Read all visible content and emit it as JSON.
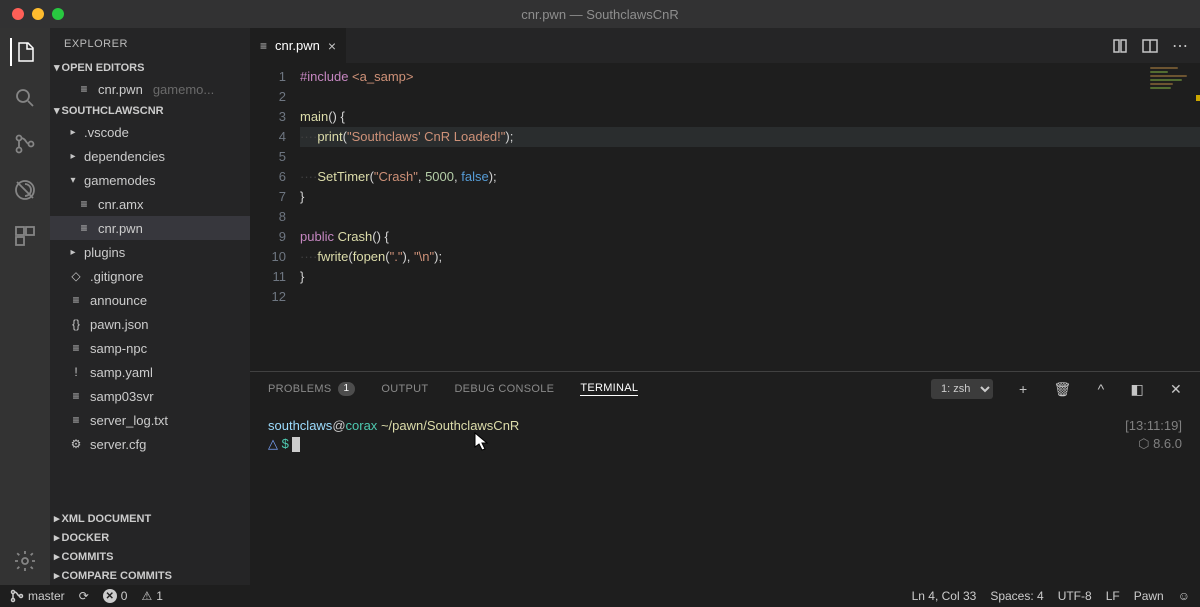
{
  "window": {
    "title": "cnr.pwn — SouthclawsCnR"
  },
  "activity": {
    "active": "explorer"
  },
  "sidebar": {
    "title": "EXPLORER",
    "sections": {
      "open_editors": "OPEN EDITORS",
      "workspace": "SOUTHCLAWSCNR",
      "xml": "XML DOCUMENT",
      "docker": "DOCKER",
      "commits": "COMMITS",
      "compare": "COMPARE COMMITS"
    },
    "open_editor_item": {
      "name": "cnr.pwn",
      "path": "gamemo..."
    },
    "tree": [
      {
        "label": ".vscode",
        "kind": "folder",
        "chev": "▸",
        "indent": 2
      },
      {
        "label": "dependencies",
        "kind": "folder",
        "chev": "▸",
        "indent": 2
      },
      {
        "label": "gamemodes",
        "kind": "folder",
        "chev": "▾",
        "indent": 2
      },
      {
        "label": "cnr.amx",
        "kind": "file",
        "icon": "≡",
        "indent": 1
      },
      {
        "label": "cnr.pwn",
        "kind": "file",
        "icon": "≡",
        "indent": 1,
        "selected": true
      },
      {
        "label": "plugins",
        "kind": "folder",
        "chev": "▸",
        "indent": 2
      },
      {
        "label": ".gitignore",
        "kind": "file",
        "icon": "◇",
        "indent": 2
      },
      {
        "label": "announce",
        "kind": "file",
        "icon": "≡",
        "indent": 2
      },
      {
        "label": "pawn.json",
        "kind": "file",
        "icon": "{}",
        "indent": 2
      },
      {
        "label": "samp-npc",
        "kind": "file",
        "icon": "≡",
        "indent": 2
      },
      {
        "label": "samp.yaml",
        "kind": "file",
        "icon": "!",
        "indent": 2
      },
      {
        "label": "samp03svr",
        "kind": "file",
        "icon": "≡",
        "indent": 2
      },
      {
        "label": "server_log.txt",
        "kind": "file",
        "icon": "≡",
        "indent": 2
      },
      {
        "label": "server.cfg",
        "kind": "file",
        "icon": "⚙",
        "indent": 2
      }
    ]
  },
  "editor": {
    "tab": {
      "label": "cnr.pwn"
    },
    "lines": [
      [
        {
          "t": "#include ",
          "c": "tk-inc"
        },
        {
          "t": "<a_samp>",
          "c": "tk-str"
        }
      ],
      [],
      [
        {
          "t": "main",
          "c": "tk-fn"
        },
        {
          "t": "() {",
          "c": "tk-plain"
        }
      ],
      [
        {
          "t": "····",
          "c": "tk-dot"
        },
        {
          "t": "print",
          "c": "tk-fn"
        },
        {
          "t": "(",
          "c": "tk-plain"
        },
        {
          "t": "\"Southclaws' CnR Loaded!\"",
          "c": "tk-str"
        },
        {
          "t": ");",
          "c": "tk-plain"
        }
      ],
      [],
      [
        {
          "t": "····",
          "c": "tk-dot"
        },
        {
          "t": "SetTimer",
          "c": "tk-fn"
        },
        {
          "t": "(",
          "c": "tk-plain"
        },
        {
          "t": "\"Crash\"",
          "c": "tk-str"
        },
        {
          "t": ", ",
          "c": "tk-plain"
        },
        {
          "t": "5000",
          "c": "tk-num"
        },
        {
          "t": ", ",
          "c": "tk-plain"
        },
        {
          "t": "false",
          "c": "tk-bool"
        },
        {
          "t": ");",
          "c": "tk-plain"
        }
      ],
      [
        {
          "t": "}",
          "c": "tk-plain"
        }
      ],
      [],
      [
        {
          "t": "public ",
          "c": "tk-kw"
        },
        {
          "t": "Crash",
          "c": "tk-fn"
        },
        {
          "t": "() {",
          "c": "tk-plain"
        }
      ],
      [
        {
          "t": "····",
          "c": "tk-dot"
        },
        {
          "t": "fwrite",
          "c": "tk-fn"
        },
        {
          "t": "(",
          "c": "tk-plain"
        },
        {
          "t": "fopen",
          "c": "tk-fn"
        },
        {
          "t": "(",
          "c": "tk-plain"
        },
        {
          "t": "\".\"",
          "c": "tk-str"
        },
        {
          "t": "), ",
          "c": "tk-plain"
        },
        {
          "t": "\"\\n\"",
          "c": "tk-str"
        },
        {
          "t": ");",
          "c": "tk-plain"
        }
      ],
      [
        {
          "t": "}",
          "c": "tk-plain"
        }
      ],
      []
    ],
    "highlight_line": 4
  },
  "panel": {
    "tabs": {
      "problems": "PROBLEMS",
      "problems_count": "1",
      "output": "OUTPUT",
      "debug": "DEBUG CONSOLE",
      "terminal": "TERMINAL"
    },
    "terminal_select": "1: zsh",
    "terminal": {
      "user": "southclaws",
      "at": "@",
      "host": "corax",
      "path": "~/pawn/SouthclawsCnR",
      "time": "[13:11:19]",
      "node_icon": "⬡",
      "node_ver": "8.6.0",
      "delta": "△",
      "dollar": "$"
    }
  },
  "status": {
    "branch": "master",
    "sync": "⟳",
    "errors": "0",
    "warnings": "1",
    "position": "Ln 4, Col 33",
    "spaces": "Spaces: 4",
    "encoding": "UTF-8",
    "eol": "LF",
    "lang": "Pawn"
  }
}
